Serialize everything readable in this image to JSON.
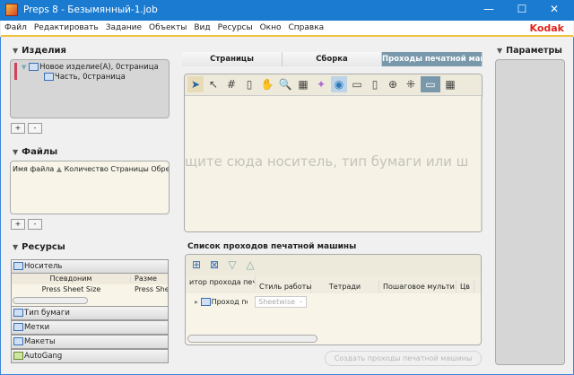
{
  "window": {
    "title": "Preps 8 - Безымянный-1.job",
    "minimize": "—",
    "maximize": "☐",
    "close": "✕"
  },
  "menu": [
    "Файл",
    "Редактировать",
    "Задание",
    "Объекты",
    "Вид",
    "Ресурсы",
    "Окно",
    "Справка"
  ],
  "brand": "Kodak",
  "products": {
    "header": "Изделия",
    "tree": [
      "Новое изделие(A), 0страница",
      "Часть, 0страница"
    ],
    "add": "+",
    "remove": "-"
  },
  "files": {
    "header": "Файлы",
    "columns": [
      "Имя файла",
      "Количество",
      "Страницы",
      "Обрезк."
    ],
    "add": "+",
    "remove": "-"
  },
  "resources": {
    "header": "Ресурсы",
    "sections": [
      "Носитель",
      "Тип бумаги",
      "Метки",
      "Макеты",
      "AutoGang"
    ],
    "columns": [
      "Псевдоним",
      "Разме"
    ],
    "row": [
      "Press Sheet Size",
      "Press She"
    ]
  },
  "tabs": [
    "Страницы",
    "Сборка",
    "Проходы печатной машины"
  ],
  "canvas": {
    "hint": "щите сюда носитель, тип бумаги или ш"
  },
  "press_list": {
    "header": "Список проходов печатной машины",
    "columns": [
      "итор прохода печати",
      "Стиль работы",
      "Тетради",
      "Пошаговое мульти",
      "Цв"
    ],
    "row": {
      "name": "Проход пе",
      "style": "Sheetwise"
    },
    "create_button": "Создать проходы печатной машины"
  },
  "params": {
    "header": "Параметры"
  },
  "colors": {
    "titlebar": "#1a7bd0",
    "active_tab": "#7a98ab",
    "accent_line": "#f0c23a",
    "brand": "#e0251b"
  }
}
